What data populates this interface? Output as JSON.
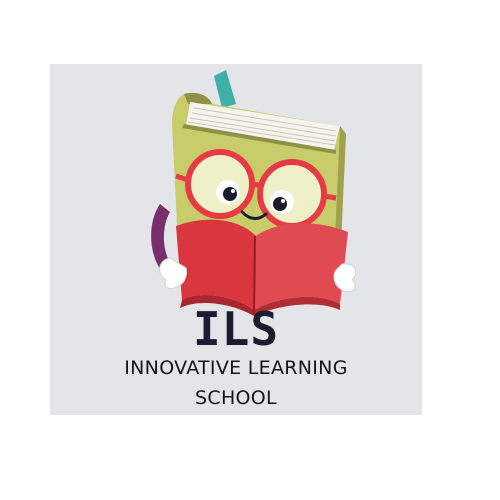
{
  "logo": {
    "acronym": "ILS",
    "name_line1": "INNOVATIVE LEARNING",
    "name_line2": "SCHOOL",
    "mascot_icon": "reading-book-mascot-icon"
  },
  "colors": {
    "panel_background": "#e3e5e8",
    "book_cover": "#c9cc6a",
    "glasses": "#e63b44",
    "open_book": "#d9363e",
    "bookmark": "#3fb0a7",
    "text": "#15161c"
  }
}
